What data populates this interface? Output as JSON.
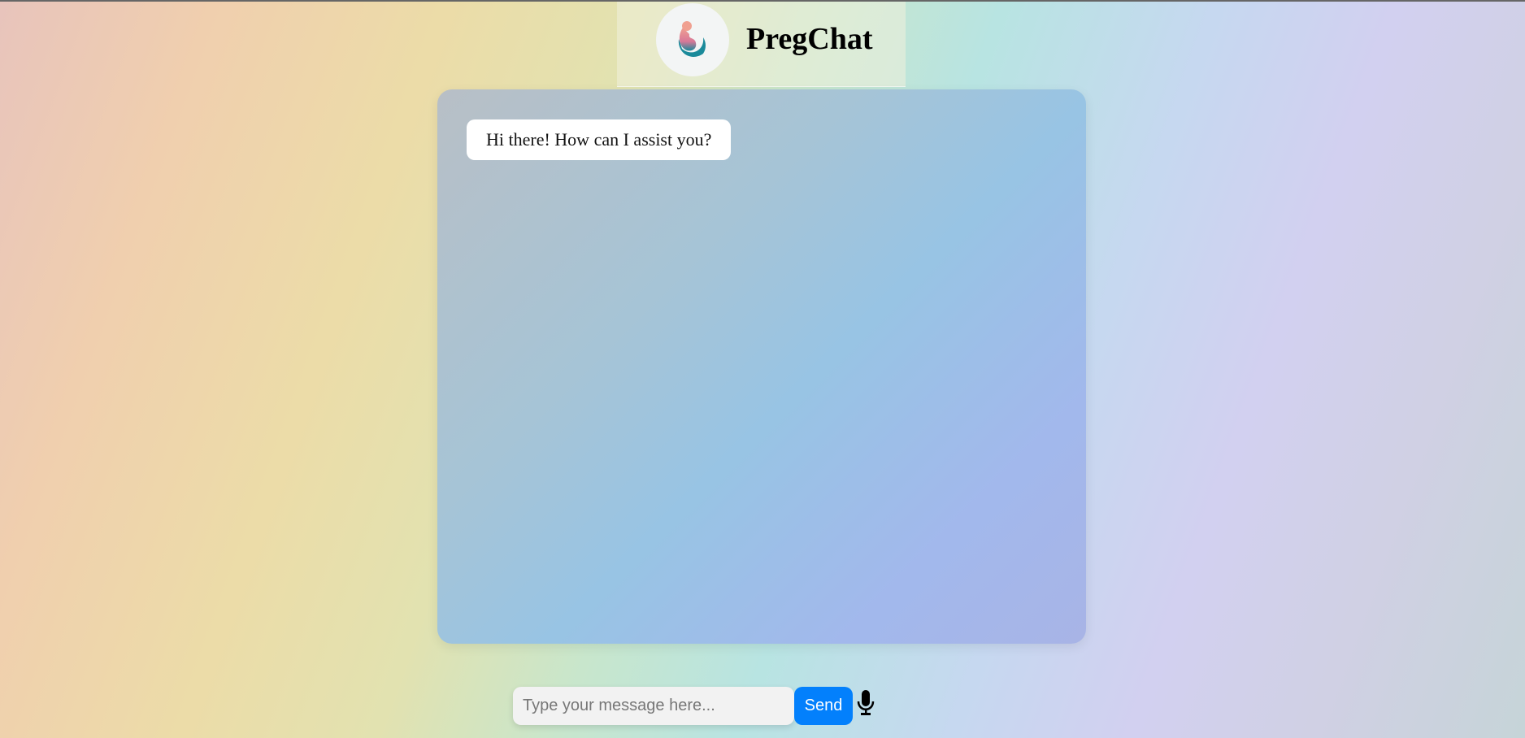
{
  "header": {
    "title": "PregChat",
    "logo_icon": "mother-baby-logo-icon"
  },
  "chat": {
    "messages": [
      {
        "sender": "bot",
        "text": "Hi there! How can I assist you?"
      }
    ]
  },
  "composer": {
    "placeholder": "Type your message here...",
    "value": "",
    "send_label": "Send",
    "mic_icon": "microphone-icon"
  },
  "colors": {
    "send": "#0380fc"
  }
}
